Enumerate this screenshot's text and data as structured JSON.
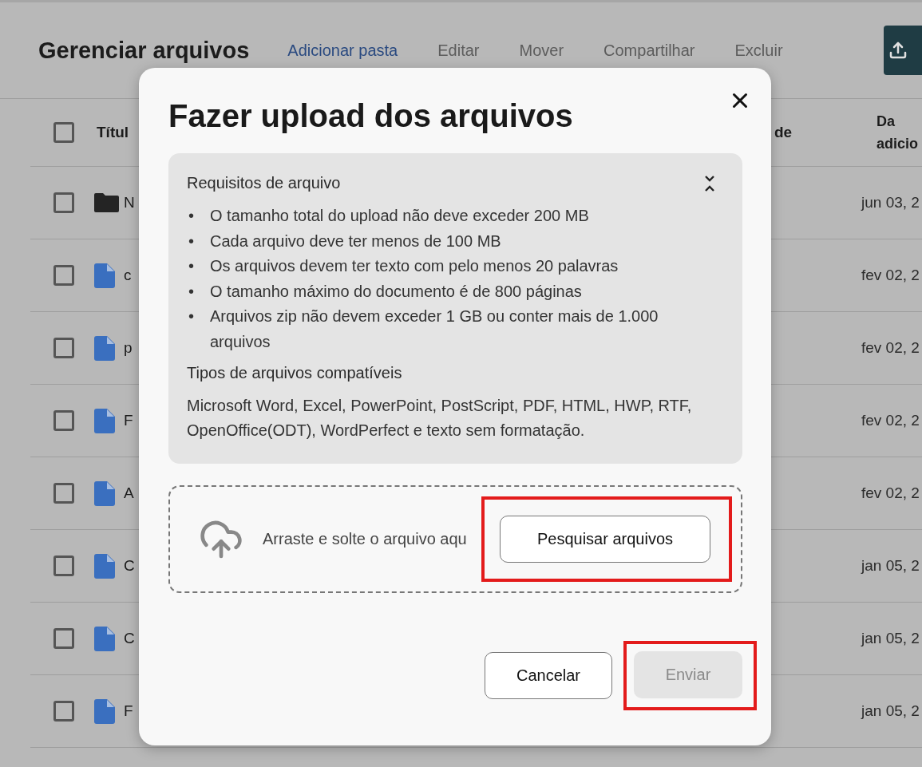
{
  "page": {
    "title": "Gerenciar arquivos",
    "actions": [
      {
        "label": "Adicionar pasta",
        "disabled": false
      },
      {
        "label": "Editar",
        "disabled": true
      },
      {
        "label": "Mover",
        "disabled": true
      },
      {
        "label": "Compartilhar",
        "disabled": true
      },
      {
        "label": "Excluir",
        "disabled": true
      }
    ]
  },
  "table": {
    "select_all": {
      "checked": false
    },
    "columns": [
      {
        "label": "Títul"
      },
      {
        "label": "de"
      },
      {
        "label": "Da adicio"
      }
    ],
    "rows": [
      {
        "kind": "folder",
        "name": "N",
        "date": "jun 03, 2",
        "checked": false
      },
      {
        "kind": "file",
        "name": "c",
        "date": "fev 02, 2",
        "checked": false
      },
      {
        "kind": "file",
        "name": "p",
        "date": "fev 02, 2",
        "checked": false
      },
      {
        "kind": "file",
        "name": "F",
        "date": "fev 02, 2",
        "checked": false
      },
      {
        "kind": "file",
        "name": "A",
        "date": "fev 02, 2",
        "checked": false
      },
      {
        "kind": "file",
        "name": "C",
        "date": "jan 05, 2",
        "checked": false
      },
      {
        "kind": "file",
        "name": "C",
        "date": "jan 05, 2",
        "checked": false
      },
      {
        "kind": "file",
        "name": "F",
        "date": "jan 05, 2",
        "checked": false
      }
    ]
  },
  "modal": {
    "title": "Fazer upload dos arquivos",
    "requirements": {
      "title": "Requisitos de arquivo",
      "expanded": true,
      "bullet": "•",
      "items": [
        "O tamanho total do upload não deve exceder 200 MB",
        "Cada arquivo deve ter menos de 100 MB",
        "Os arquivos devem ter texto com pelo menos 20 palavras",
        "O tamanho máximo do documento é de 800 páginas",
        "Arquivos zip não devem exceder 1 GB ou conter mais de 1.000 arquivos"
      ],
      "types_title": "Tipos de arquivos compatíveis",
      "types_text": "Microsoft Word, Excel, PowerPoint, PostScript, PDF, HTML, HWP, RTF, OpenOffice(ODT), WordPerfect e texto sem formatação."
    },
    "dropzone": {
      "text": "Arraste e solte o arquivo aqu",
      "button": {
        "label": "Pesquisar arquivos",
        "highlighted": true
      }
    },
    "buttons": [
      {
        "label": "Cancelar",
        "kind": "secondary",
        "disabled": false,
        "highlighted": false
      },
      {
        "label": "Enviar",
        "kind": "primary",
        "disabled": true,
        "highlighted": true
      }
    ]
  }
}
